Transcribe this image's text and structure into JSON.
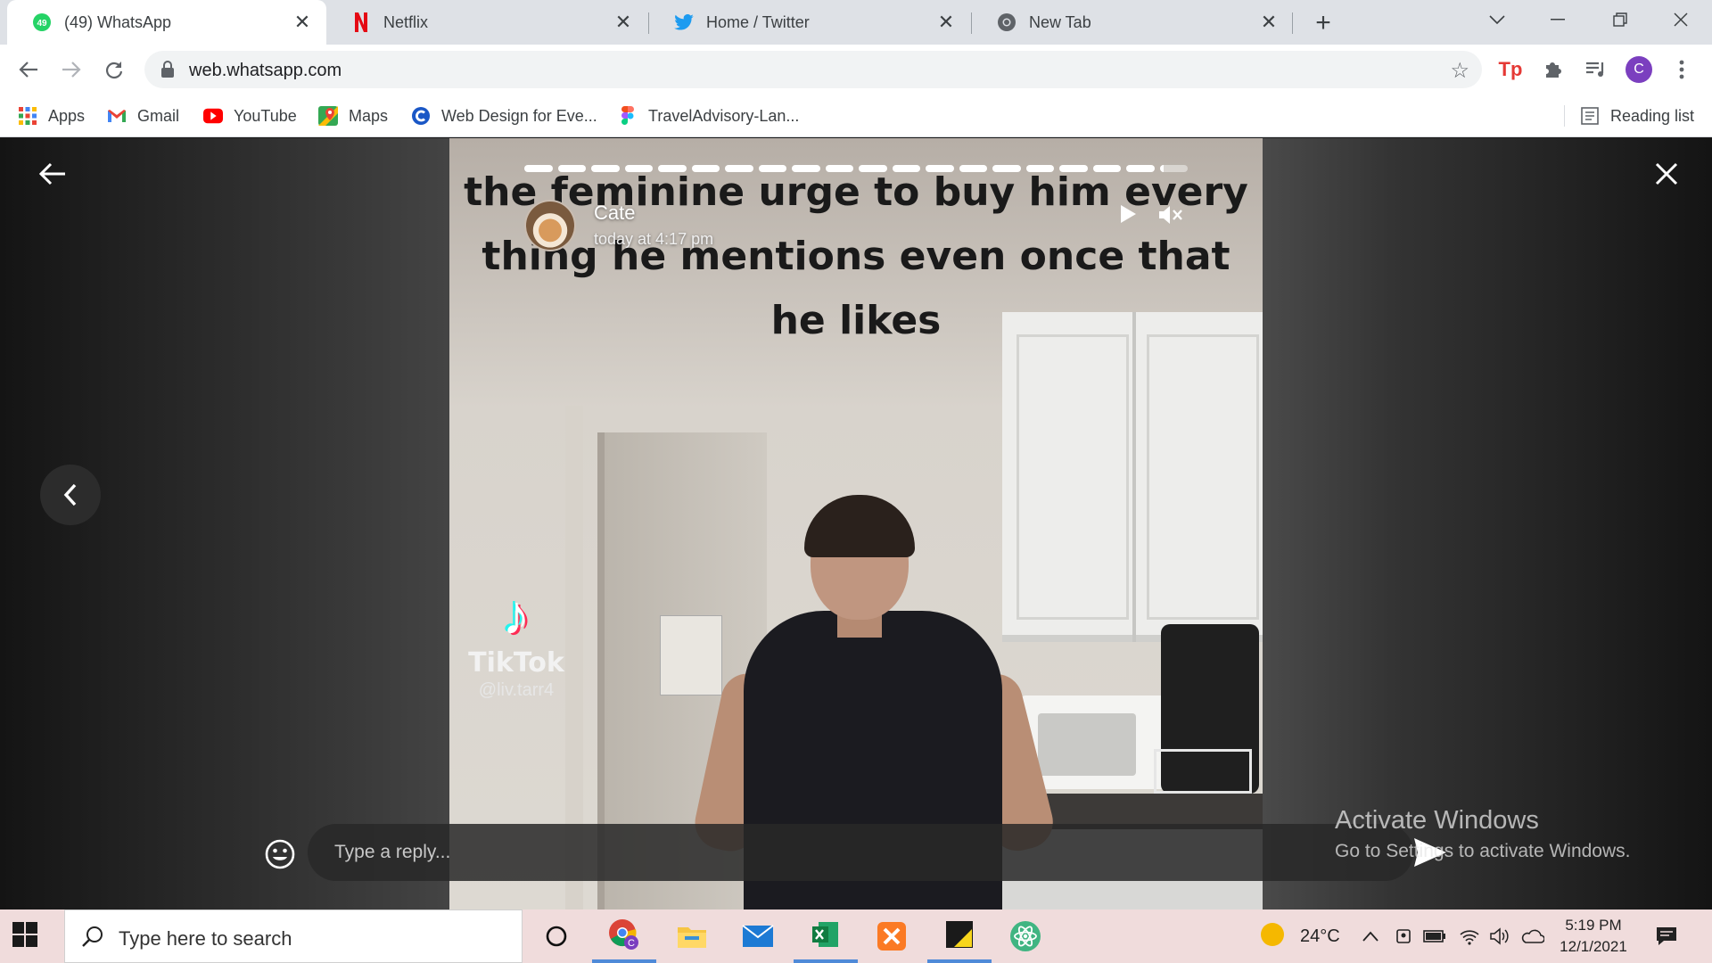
{
  "browser": {
    "tabs": [
      {
        "label": "(49) WhatsApp",
        "badge": "49",
        "icon": "whatsapp-icon",
        "active": true
      },
      {
        "label": "Netflix",
        "icon": "netflix-icon",
        "active": false
      },
      {
        "label": "Home / Twitter",
        "icon": "twitter-icon",
        "active": false
      },
      {
        "label": "New Tab",
        "icon": "chrome-icon",
        "active": false
      }
    ],
    "url": "web.whatsapp.com",
    "profile_initial": "C",
    "bookmarks": [
      {
        "label": "Apps",
        "icon": "apps-grid-icon"
      },
      {
        "label": "Gmail",
        "icon": "gmail-icon"
      },
      {
        "label": "YouTube",
        "icon": "youtube-icon"
      },
      {
        "label": "Maps",
        "icon": "maps-icon"
      },
      {
        "label": "Web Design for Eve...",
        "icon": "site-c-icon"
      },
      {
        "label": "TravelAdvisory-Lan...",
        "icon": "figma-icon"
      }
    ],
    "reading_list": "Reading list"
  },
  "status_viewer": {
    "contact_name": "Cate",
    "timestamp": "today at 4:17 pm",
    "segments_total": 20,
    "segments_viewed": 19,
    "current_segment_progress": 0.15,
    "caption": "the feminine urge to buy him every thing he mentions even once that he likes",
    "watermark": {
      "brand": "TikTok",
      "handle": "@liv.tarr4"
    },
    "reply_placeholder": "Type a reply...",
    "colors": {
      "accent": "#ffffff",
      "background": "#2d2d2d"
    }
  },
  "windows_overlay": {
    "title": "Activate Windows",
    "subtitle": "Go to Settings to activate Windows."
  },
  "taskbar": {
    "search_placeholder": "Type here to search",
    "weather": "24°C",
    "time": "5:19 PM",
    "date": "12/1/2021",
    "apps": [
      "task-view",
      "chrome",
      "file-explorer",
      "mail",
      "excel",
      "xampp",
      "sticky-notes",
      "atom"
    ]
  }
}
